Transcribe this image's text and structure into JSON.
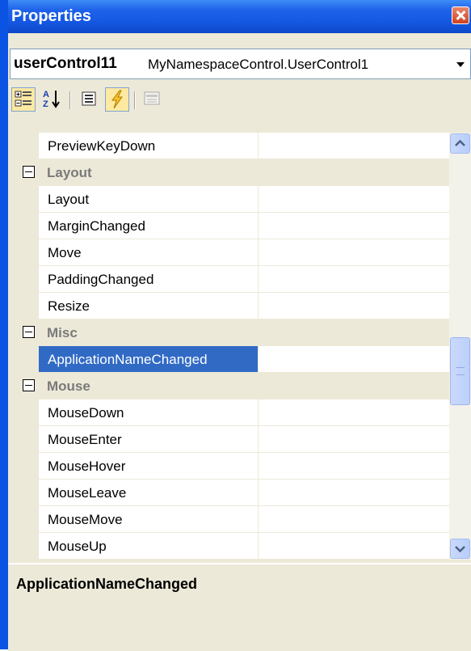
{
  "window": {
    "title": "Properties"
  },
  "object_selector": {
    "name": "userControl11",
    "type": "MyNamespaceControl.UserControl1"
  },
  "toolbar": {
    "buttons": [
      {
        "icon": "categorized-icon",
        "pressed": true
      },
      {
        "icon": "alphabetical-icon",
        "pressed": false
      },
      {
        "icon": "properties-icon",
        "pressed": false
      },
      {
        "icon": "events-icon",
        "pressed": true
      },
      {
        "icon": "property-pages-icon",
        "pressed": false,
        "disabled": true
      }
    ]
  },
  "grid": {
    "rows": [
      {
        "kind": "prop",
        "name": "PreviewKeyDown"
      },
      {
        "kind": "category",
        "name": "Layout"
      },
      {
        "kind": "prop",
        "name": "Layout"
      },
      {
        "kind": "prop",
        "name": "MarginChanged"
      },
      {
        "kind": "prop",
        "name": "Move"
      },
      {
        "kind": "prop",
        "name": "PaddingChanged"
      },
      {
        "kind": "prop",
        "name": "Resize"
      },
      {
        "kind": "category",
        "name": "Misc"
      },
      {
        "kind": "prop",
        "name": "ApplicationNameChanged",
        "selected": true
      },
      {
        "kind": "category",
        "name": "Mouse"
      },
      {
        "kind": "prop",
        "name": "MouseDown"
      },
      {
        "kind": "prop",
        "name": "MouseEnter"
      },
      {
        "kind": "prop",
        "name": "MouseHover"
      },
      {
        "kind": "prop",
        "name": "MouseLeave"
      },
      {
        "kind": "prop",
        "name": "MouseMove"
      },
      {
        "kind": "prop",
        "name": "MouseUp"
      }
    ]
  },
  "description": {
    "title": "ApplicationNameChanged"
  },
  "colors": {
    "selection": "#316ac5",
    "category_text": "#7a7a7a",
    "title_bar": "#1356e0",
    "panel": "#ece9d8"
  }
}
